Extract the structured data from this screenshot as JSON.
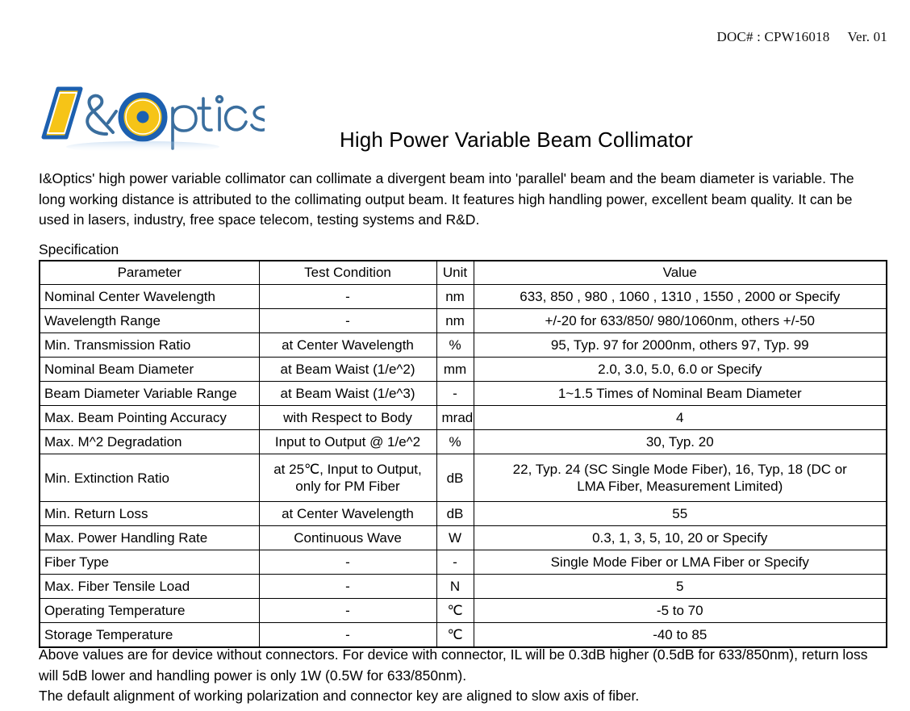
{
  "header": {
    "doc_label": "DOC# : CPW16018",
    "version_label": "Ver. 01"
  },
  "logo": {
    "text": "I&Optics",
    "bar_fill": "#F6C417",
    "bar_stroke": "#1C60B0",
    "ring_stroke": "#1C60B0",
    "ring_fill": "#F6C417",
    "dot_fill": "#1C60B0",
    "letter_stroke": "#3A6E9E",
    "letter_fill": "#FFFFFF"
  },
  "title": "High Power Variable Beam Collimator",
  "intro": "I&Optics' high power variable collimator can collimate a divergent beam into 'parallel' beam and the beam diameter is variable. The long working distance is attributed to the collimating output beam. It features high handling power, excellent beam quality. It can be used in lasers, industry, free space telecom, testing systems and R&D.",
  "spec_label": "Specification",
  "table": {
    "columns": [
      "Parameter",
      "Test Condition",
      "Unit",
      "Value"
    ],
    "rows": [
      {
        "parameter": "Nominal Center Wavelength",
        "condition": "-",
        "unit": "nm",
        "value": "633, 850 , 980 , 1060 , 1310 , 1550 , 2000 or Specify"
      },
      {
        "parameter": "Wavelength Range",
        "condition": "-",
        "unit": "nm",
        "value": "+/-20 for 633/850/ 980/1060nm, others +/-50"
      },
      {
        "parameter": "Min. Transmission Ratio",
        "condition": "at Center Wavelength",
        "unit": "%",
        "value": "95, Typ. 97 for 2000nm, others 97, Typ. 99"
      },
      {
        "parameter": "Nominal Beam Diameter",
        "condition": "at Beam Waist (1/e^2)",
        "unit": "mm",
        "value": "2.0, 3.0, 5.0, 6.0 or Specify"
      },
      {
        "parameter": "Beam Diameter Variable Range",
        "condition": "at Beam Waist (1/e^3)",
        "unit": "-",
        "value": "1~1.5 Times of Nominal Beam Diameter"
      },
      {
        "parameter": "Max. Beam Pointing Accuracy",
        "condition": "with Respect to Body",
        "unit": "mrad",
        "value": "4"
      },
      {
        "parameter": "Max. M^2 Degradation",
        "condition": "Input to Output @ 1/e^2",
        "unit": "%",
        "value": "30, Typ. 20"
      },
      {
        "parameter": "Min. Extinction Ratio",
        "condition_line1": "at 25℃, Input to Output,",
        "condition_line2": "only for PM Fiber",
        "unit": "dB",
        "value_line1": "22, Typ. 24 (SC Single Mode Fiber), 16, Typ, 18 (DC or",
        "value_line2": "LMA Fiber, Measurement Limited)"
      },
      {
        "parameter": "Min. Return Loss",
        "condition": "at Center Wavelength",
        "unit": "dB",
        "value": "55"
      },
      {
        "parameter": "Max. Power Handling Rate",
        "condition": "Continuous Wave",
        "unit": "W",
        "value": "0.3, 1, 3, 5, 10, 20 or Specify"
      },
      {
        "parameter": "Fiber Type",
        "condition": "-",
        "unit": "-",
        "value": "Single Mode Fiber or LMA Fiber or Specify"
      },
      {
        "parameter": "Max. Fiber Tensile Load",
        "condition": "-",
        "unit": "N",
        "value": "5"
      },
      {
        "parameter": "Operating Temperature",
        "condition": "-",
        "unit": "℃",
        "value": "-5 to 70"
      },
      {
        "parameter": "Storage Temperature",
        "condition": "-",
        "unit": "℃",
        "value": "-40 to 85"
      }
    ]
  },
  "notes": {
    "note1": "Above values are for device without connectors. For device with connector, IL will be 0.3dB higher (0.5dB for 633/850nm), return loss will 5dB lower and handling power is only 1W (0.5W for 633/850nm).",
    "note2": "The default alignment of working polarization and connector key are aligned to slow axis of fiber."
  }
}
